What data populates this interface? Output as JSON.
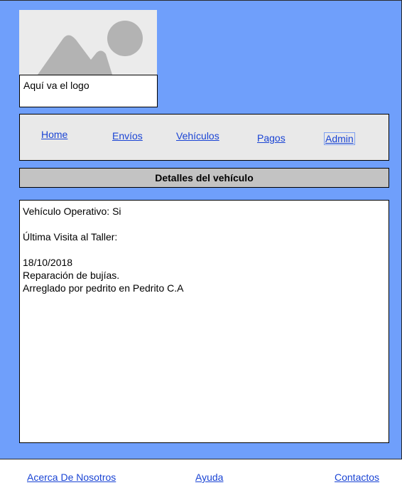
{
  "logo": {
    "caption": "Aquí va el logo",
    "image_icon": "image-placeholder-icon"
  },
  "nav": {
    "items": [
      {
        "label": "Home"
      },
      {
        "label": "Envíos"
      },
      {
        "label": "Vehículos"
      },
      {
        "label": "Pagos"
      },
      {
        "label": "Admin"
      }
    ]
  },
  "section": {
    "title": "Detalles del vehículo"
  },
  "details": {
    "lines": [
      "Vehículo Operativo: Si",
      "",
      "Última Visita al Taller:",
      "",
      "18/10/2018",
      "Reparación de bujías.",
      "Arreglado por pedrito en Pedrito C.A"
    ]
  },
  "footer": {
    "links": [
      {
        "label": "Acerca De Nosotros"
      },
      {
        "label": "Ayuda"
      },
      {
        "label": "Contactos"
      }
    ]
  },
  "colors": {
    "page_background": "#6f9ffb",
    "link": "#1a44d4",
    "nav_background": "#e9e9e9",
    "header_background": "#c3c3c3"
  }
}
